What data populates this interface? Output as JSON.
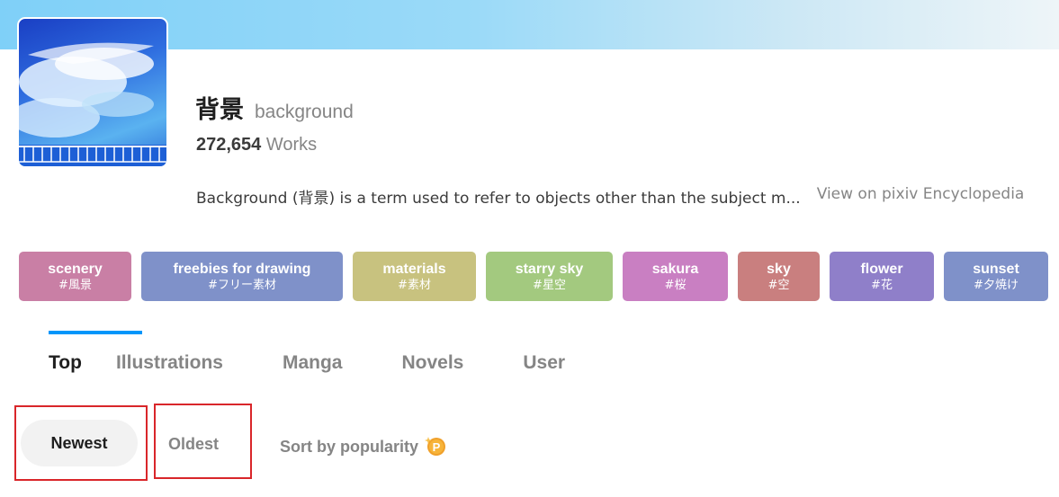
{
  "tag": {
    "title": "背景",
    "translation": "background",
    "works_count": "272,654",
    "works_label": "Works",
    "description": "Background (背景) is a term used to refer to objects other than the subject m...",
    "encyclopedia_link": "View on pixiv Encyclopedia"
  },
  "related_tags": [
    {
      "en": "scenery",
      "jp": "#風景",
      "color": "#c97fa5"
    },
    {
      "en": "freebies for drawing",
      "jp": "#フリー素材",
      "color": "#7f91c9"
    },
    {
      "en": "materials",
      "jp": "#素材",
      "color": "#c8c27f"
    },
    {
      "en": "starry sky",
      "jp": "#星空",
      "color": "#a3c97f"
    },
    {
      "en": "sakura",
      "jp": "#桜",
      "color": "#c97fc2"
    },
    {
      "en": "sky",
      "jp": "#空",
      "color": "#c97f7f"
    },
    {
      "en": "flower",
      "jp": "#花",
      "color": "#8f7fc9"
    },
    {
      "en": "sunset",
      "jp": "#夕焼け",
      "color": "#7f91c9"
    }
  ],
  "tabs": [
    {
      "label": "Top",
      "active": true
    },
    {
      "label": "Illustrations"
    },
    {
      "label": "Manga"
    },
    {
      "label": "Novels"
    },
    {
      "label": "User"
    }
  ],
  "sort": {
    "newest": "Newest",
    "oldest": "Oldest",
    "popular": "Sort by popularity",
    "premium_icon": "premium-p-icon"
  },
  "colors": {
    "accent": "#0096fa",
    "highlight": "#d9262a",
    "premium": "#f0a02a"
  }
}
